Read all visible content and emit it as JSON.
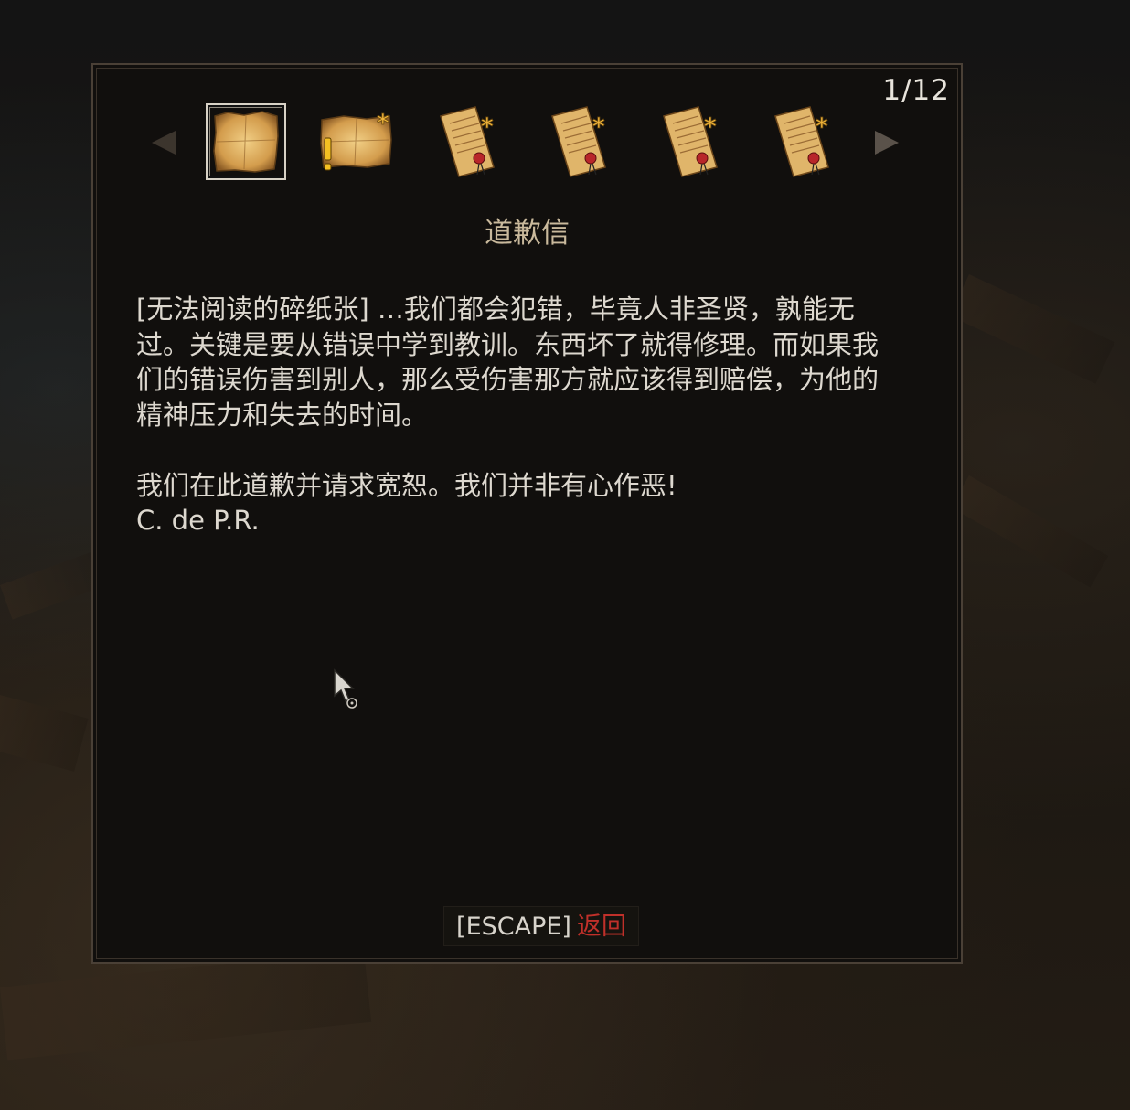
{
  "journal": {
    "counter": "1/12",
    "title": "道歉信",
    "body": "[无法阅读的碎纸张] …我们都会犯错，毕竟人非圣贤，孰能无过。关键是要从错误中学到教训。东西坏了就得修理。而如果我们的错误伤害到别人，那么受伤害那方就应该得到赔偿，为他的精神压力和失去的时间。\n\n我们在此道歉并请求宽恕。我们并非有心作恶!\nC. de P.R.",
    "prev_icon": "triangle-left-icon",
    "next_icon": "triangle-right-icon",
    "items": [
      {
        "icon": "torn-paper-scrap-icon",
        "selected": true
      },
      {
        "icon": "map-scroll-quest-icon",
        "selected": false
      },
      {
        "icon": "sealed-letter-icon",
        "selected": false
      },
      {
        "icon": "sealed-letter-icon",
        "selected": false
      },
      {
        "icon": "sealed-letter-icon",
        "selected": false
      },
      {
        "icon": "sealed-letter-icon",
        "selected": false
      }
    ]
  },
  "footer": {
    "escape_key": "[ESCAPE]",
    "escape_action": "返回"
  },
  "colors": {
    "panel_bg": "#110f0d",
    "title": "#c9b99c",
    "body_text": "#ddd8cf",
    "escape_action": "#c0302a",
    "parchment": "#d9a95c"
  }
}
